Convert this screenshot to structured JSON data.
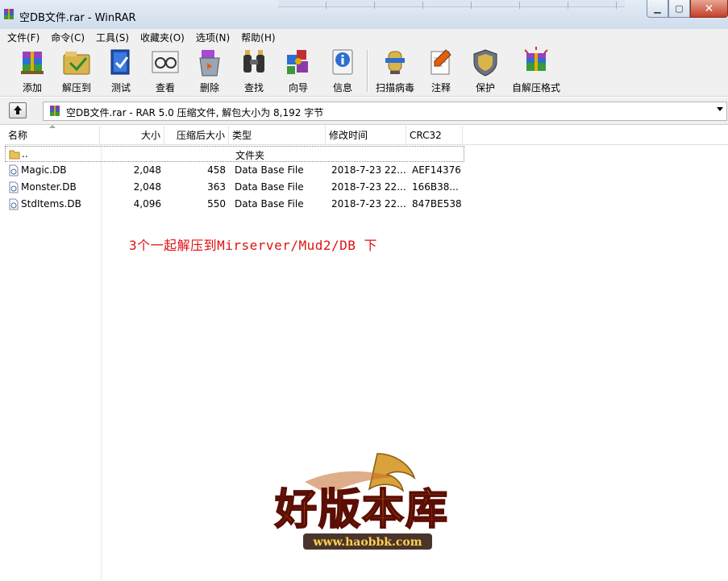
{
  "window": {
    "title": "空DB文件.rar - WinRAR",
    "controls": [
      "minimize",
      "maximize",
      "close"
    ]
  },
  "menu": [
    "文件(F)",
    "命令(C)",
    "工具(S)",
    "收藏夹(O)",
    "选项(N)",
    "帮助(H)"
  ],
  "toolbar": [
    {
      "label": "添加",
      "icon": "add-icon"
    },
    {
      "label": "解压到",
      "icon": "extract-to-icon"
    },
    {
      "label": "测试",
      "icon": "test-icon"
    },
    {
      "label": "查看",
      "icon": "view-icon"
    },
    {
      "label": "删除",
      "icon": "delete-icon"
    },
    {
      "label": "查找",
      "icon": "find-icon"
    },
    {
      "label": "向导",
      "icon": "wizard-icon"
    },
    {
      "label": "信息",
      "icon": "info-icon"
    },
    {
      "label": "扫描病毒",
      "icon": "virus-scan-icon"
    },
    {
      "label": "注释",
      "icon": "comment-icon"
    },
    {
      "label": "保护",
      "icon": "protect-icon"
    },
    {
      "label": "自解压格式",
      "icon": "sfx-icon"
    }
  ],
  "address": {
    "text": "空DB文件.rar - RAR 5.0 压缩文件, 解包大小为 8,192 字节"
  },
  "columns": {
    "name": "名称",
    "size": "大小",
    "packed": "压缩后大小",
    "type": "类型",
    "modified": "修改时间",
    "crc": "CRC32"
  },
  "files": [
    {
      "name": "..",
      "size": "",
      "packed": "",
      "type": "文件夹",
      "modified": "",
      "crc": ""
    },
    {
      "name": "Magic.DB",
      "size": "2,048",
      "packed": "458",
      "type": "Data Base File",
      "modified": "2018-7-23 22...",
      "crc": "AEF14376"
    },
    {
      "name": "Monster.DB",
      "size": "2,048",
      "packed": "363",
      "type": "Data Base File",
      "modified": "2018-7-23 22...",
      "crc": "166B38..."
    },
    {
      "name": "StdItems.DB",
      "size": "4,096",
      "packed": "550",
      "type": "Data Base File",
      "modified": "2018-7-23 22...",
      "crc": "847BE538"
    }
  ],
  "annotation": "3个一起解压到Mirserver/Mud2/DB 下",
  "watermark": {
    "title": "好版本库",
    "url": "www.haobbk.com"
  },
  "colors": {
    "annotation": "#e01010",
    "titlebar": "#dbe5f1",
    "close_button": "#c4402a"
  }
}
